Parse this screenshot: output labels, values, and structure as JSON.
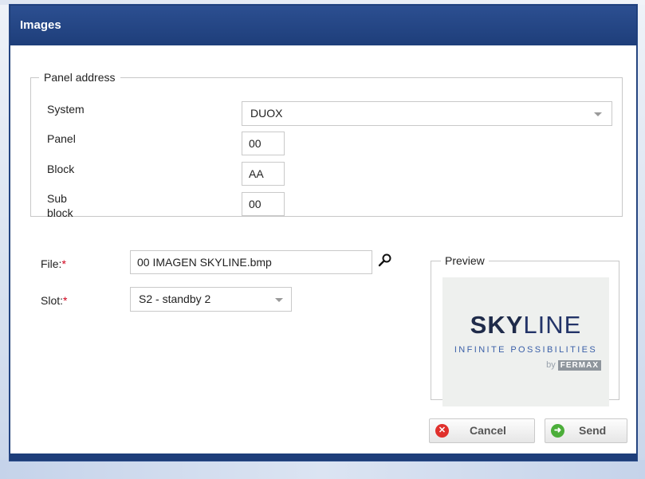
{
  "dialog": {
    "title": "Images"
  },
  "panel_address": {
    "legend": "Panel address",
    "system_label": "System",
    "system_value": "DUOX",
    "panel_label": "Panel",
    "panel_value": "00",
    "block_label": "Block",
    "block_value": "AA",
    "subblock_label_line1": "Sub",
    "subblock_label_line2": "block",
    "subblock_value": "00"
  },
  "file": {
    "label": "File:",
    "required_mark": "*",
    "value": "00 IMAGEN SKYLINE.bmp"
  },
  "slot": {
    "label": "Slot:",
    "required_mark": "*",
    "value": "S2 - standby 2"
  },
  "preview": {
    "legend": "Preview",
    "logo_bold": "SKY",
    "logo_light": "LINE",
    "tagline": "INFINITE POSSIBILITIES",
    "by": "by",
    "brand": "FERMAX"
  },
  "buttons": {
    "cancel": "Cancel",
    "send": "Send"
  },
  "colors": {
    "title_bar": "#1e3e7a",
    "cancel_icon": "#e0302c",
    "send_icon": "#4cae3a",
    "required": "#d0021b"
  }
}
